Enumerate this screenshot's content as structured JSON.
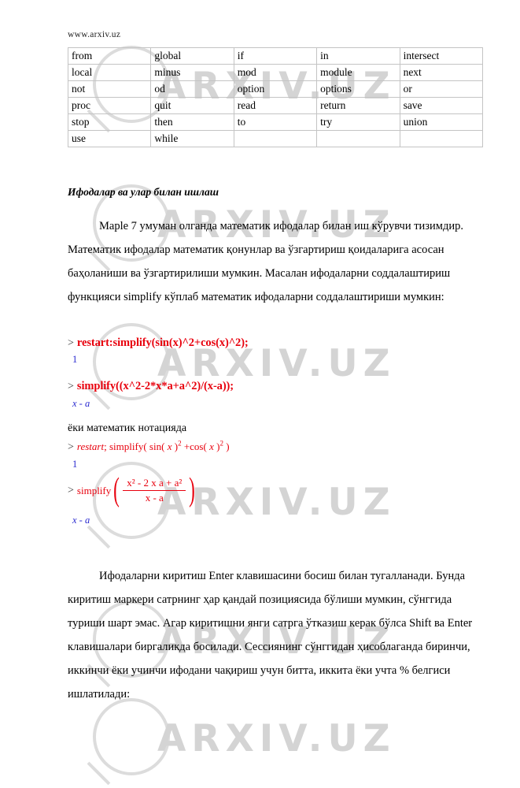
{
  "page": {
    "site_url": "www.arxiv.uz",
    "watermark_text": "ARXIV.UZ"
  },
  "keyword_table": {
    "rows": [
      [
        "from",
        "global",
        "if",
        "in",
        "intersect"
      ],
      [
        "local",
        "minus",
        "mod",
        "module",
        "next"
      ],
      [
        "not",
        "od",
        "option",
        "options",
        "or"
      ],
      [
        "proc",
        "quit",
        "read",
        "return",
        "save"
      ],
      [
        "stop",
        "then",
        "to",
        "try",
        "union"
      ],
      [
        "use",
        "while",
        "",
        "",
        ""
      ]
    ]
  },
  "section": {
    "heading": "Ифодалар ва улар билан ишлаш",
    "intro_paragraph": "Maple 7  умуман олганда математик ифодалар билан иш кўрувчи тизимдир. Математик ифодалар математик қонунлар ва ўзгартириш қоидаларига асосан баҳоланиши ва ўзгартирилиши мумкин. Масалан ифодаларни соддалаштириш функцияси simplify кўплаб математик ифодаларни соддалаштириши мумкин:",
    "notation_line": "ёки математик нотацияда",
    "outro_paragraph": "Ифодаларни киритиш Enter клавишасини босиш билан тугалланади. Бунда киритиш маркери сатрнинг ҳар қандай позициясида бўлиши мумкин, сўнггида туриши шарт эмас. Агар киритишни янги сатрга ўтказиш керак бўлса Shift ва Enter клавишалари биргаликда босилади. Сессиянинг сўнггидан ҳисоблаганда биринчи, иккинчи ёки учинчи ифодани чақириш учун битта, иккита ёки учта % белгиси ишлатилади:"
  },
  "maple": {
    "prompt": ">",
    "command_1": "restart:simplify(sin(x)^2+cos(x)^2);",
    "result_1": "1",
    "command_2": "simplify((x^2-2*x*a+a^2)/(x-a));",
    "result_2": "x - a",
    "command_3_keyword": "restart",
    "command_3_sep": ";",
    "command_3_fn": "simplify",
    "command_3_body_sin": "sin",
    "command_3_body_cos": "cos",
    "command_3_var": "x",
    "command_3_exp": "2",
    "result_3": "1",
    "command_4_fn": "simplify",
    "command_4_num": "x² - 2 x a + a²",
    "command_4_den": "x - a",
    "result_4": "x - a"
  },
  "colors": {
    "code_red": "#e8000d",
    "result_blue": "#2b2bd0",
    "table_border": "#c4c4c4",
    "watermark_gray": "#d4d4d4"
  }
}
